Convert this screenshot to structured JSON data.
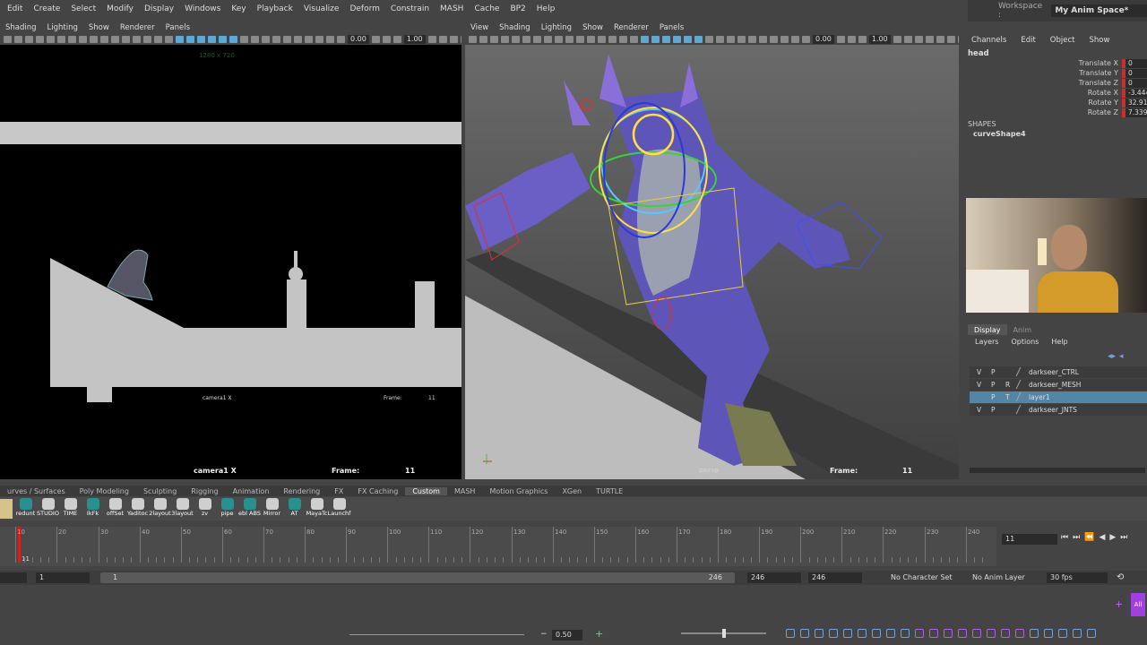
{
  "menu": [
    "Edit",
    "Create",
    "Select",
    "Modify",
    "Display",
    "Windows",
    "Key",
    "Playback",
    "Visualize",
    "Deform",
    "Constrain",
    "MASH",
    "Cache",
    "BP2",
    "Help"
  ],
  "workspace": {
    "label": "Workspace :",
    "value": "My Anim Space*"
  },
  "left_panel": {
    "menu": [
      "Shading",
      "Lighting",
      "Show",
      "Renderer",
      "Panels"
    ],
    "num1": "0.00",
    "num2": "1.00",
    "resolution": "1280 x 720",
    "camera": "camera1 X",
    "frame_label": "Frame:",
    "frame": "11",
    "inner_camera": "camera1 X",
    "inner_frame_label": "Frame:",
    "inner_frame": "11"
  },
  "right_panel": {
    "menu": [
      "View",
      "Shading",
      "Lighting",
      "Show",
      "Renderer",
      "Panels"
    ],
    "num1": "0.00",
    "num2": "1.00",
    "camera": "persp",
    "frame_label": "Frame:",
    "frame": "11"
  },
  "channels": {
    "menu": [
      "Channels",
      "Edit",
      "Object",
      "Show"
    ],
    "node": "head",
    "attrs": [
      {
        "name": "Translate X",
        "value": "0"
      },
      {
        "name": "Translate Y",
        "value": "0"
      },
      {
        "name": "Translate Z",
        "value": "0"
      },
      {
        "name": "Rotate X",
        "value": "-3.444"
      },
      {
        "name": "Rotate Y",
        "value": "32.917"
      },
      {
        "name": "Rotate Z",
        "value": "7.339"
      }
    ],
    "shapes_header": "SHAPES",
    "shape": "curveShape4"
  },
  "layers": {
    "tabs": [
      "Display",
      "Anim"
    ],
    "menu": [
      "Layers",
      "Options",
      "Help"
    ],
    "rows": [
      {
        "v": "V",
        "p": "P",
        "r": "",
        "name": "darkseer_CTRL",
        "selected": false
      },
      {
        "v": "V",
        "p": "P",
        "r": "R",
        "name": "darkseer_MESH",
        "selected": false
      },
      {
        "v": "",
        "p": "P",
        "r": "T",
        "name": "layer1",
        "selected": true
      },
      {
        "v": "V",
        "p": "P",
        "r": "",
        "name": "darkseer_JNTS",
        "selected": false
      }
    ]
  },
  "shelf_tabs": [
    "urves / Surfaces",
    "Poly Modeling",
    "Sculpting",
    "Rigging",
    "Animation",
    "Rendering",
    "FX",
    "FX Caching",
    "Custom",
    "MASH",
    "Motion Graphics",
    "XGen",
    "TURTLE"
  ],
  "shelf_active": "Custom",
  "shelf_buttons": [
    "redunt",
    "STUDIO",
    "TIME",
    "IkFk",
    "offSet",
    "Yaditoc",
    "2layout",
    "3layout",
    "zv",
    "pipe",
    "ebl ABS",
    "Mirror",
    "AT",
    "MayaTc",
    "Launchf"
  ],
  "timeline": {
    "labels": [
      "10",
      "20",
      "30",
      "40",
      "50",
      "60",
      "70",
      "80",
      "90",
      "100",
      "110",
      "120",
      "130",
      "140",
      "150",
      "160",
      "170",
      "180",
      "190",
      "200",
      "210",
      "220",
      "230",
      "240"
    ],
    "current": "11",
    "current_field": "11"
  },
  "range": {
    "start": "1",
    "inner_start": "1",
    "inner_end": "246",
    "end1": "246",
    "end2": "246",
    "character_set": "No Character Set",
    "anim_layer": "No Anim Layer",
    "fps": "30 fps"
  },
  "bottom": {
    "value": "0.50",
    "badge": "All"
  }
}
